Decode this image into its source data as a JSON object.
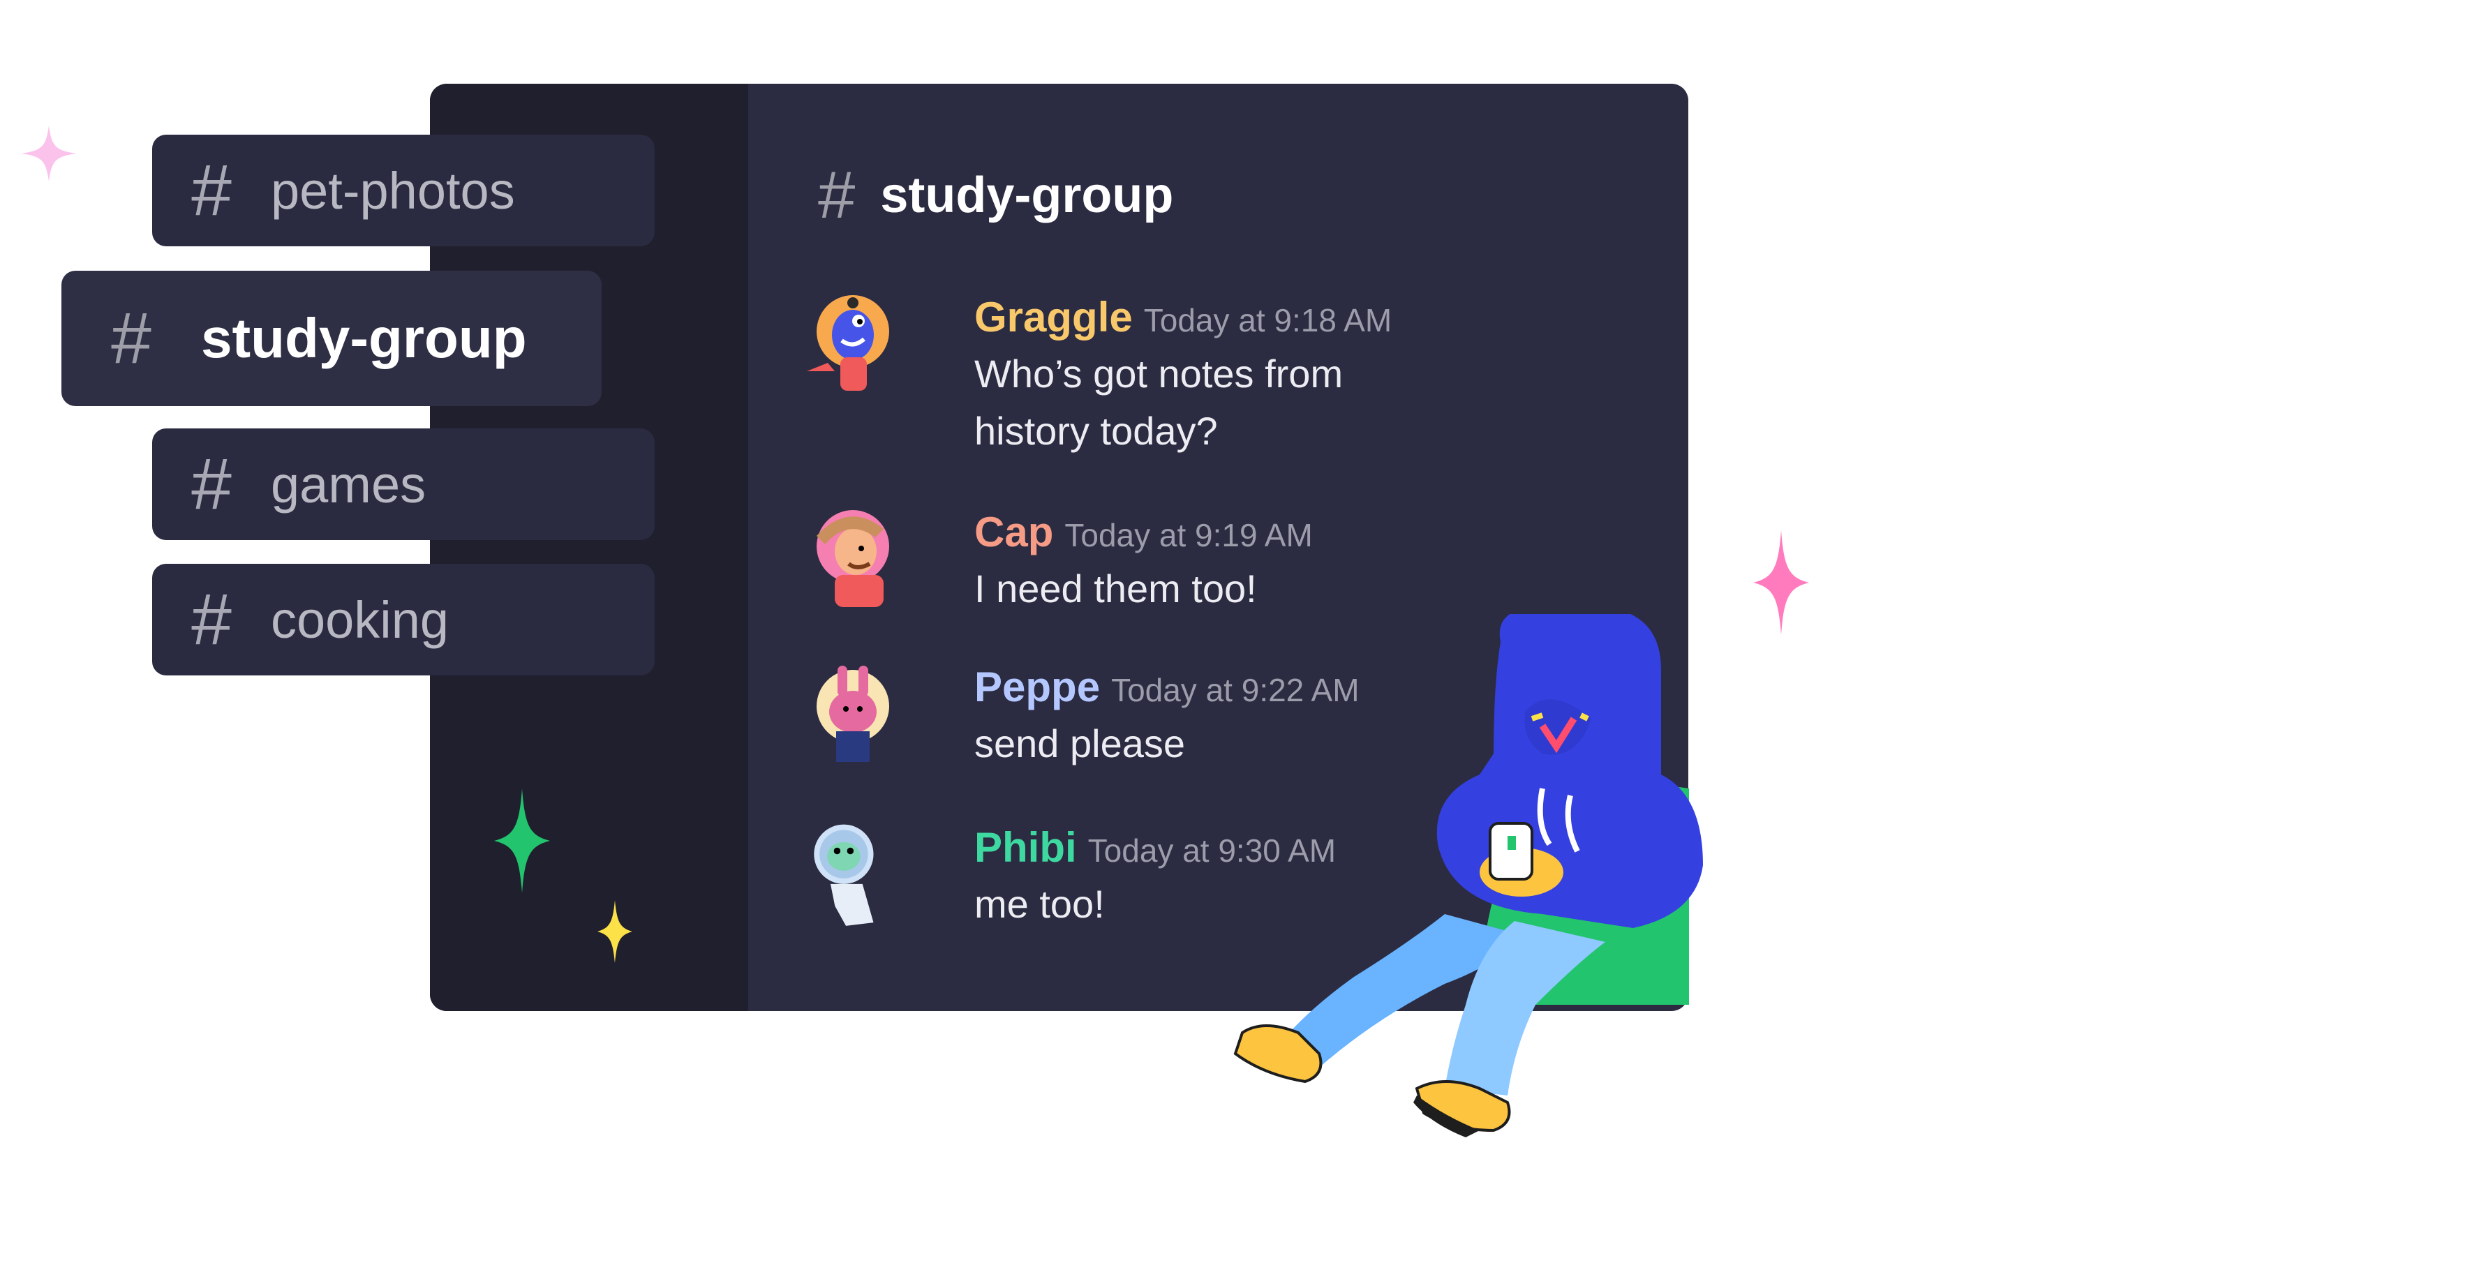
{
  "channel_list": [
    {
      "name": "pet-photos",
      "active": false
    },
    {
      "name": "study-group",
      "active": true
    },
    {
      "name": "games",
      "active": false
    },
    {
      "name": "cooking",
      "active": false
    }
  ],
  "hash_symbol": "#",
  "chat": {
    "channel_title": "study-group",
    "messages": [
      {
        "author": "Graggle",
        "time": "Today at 9:18 AM",
        "lines": [
          "Who’s got notes from",
          "history today?"
        ],
        "color": "#f8c86b"
      },
      {
        "author": "Cap",
        "time": "Today at 9:19 AM",
        "lines": [
          "I need them too!"
        ],
        "color": "#f69b85"
      },
      {
        "author": "Peppe",
        "time": "Today at 9:22 AM",
        "lines": [
          "send please"
        ],
        "color": "#b4c8ff"
      },
      {
        "author": "Phibi",
        "time": "Today at 9:30 AM",
        "lines": [
          "me too!"
        ],
        "color": "#3dd9a0"
      }
    ]
  },
  "colors": {
    "window_bg": "#2b2b41",
    "sidebar_bg": "#1f1f2d",
    "sparkle_pink": "#ff7bbd",
    "sparkle_green": "#23c46e",
    "sparkle_yellow": "#fde148",
    "character_blue": "#3440e0"
  }
}
